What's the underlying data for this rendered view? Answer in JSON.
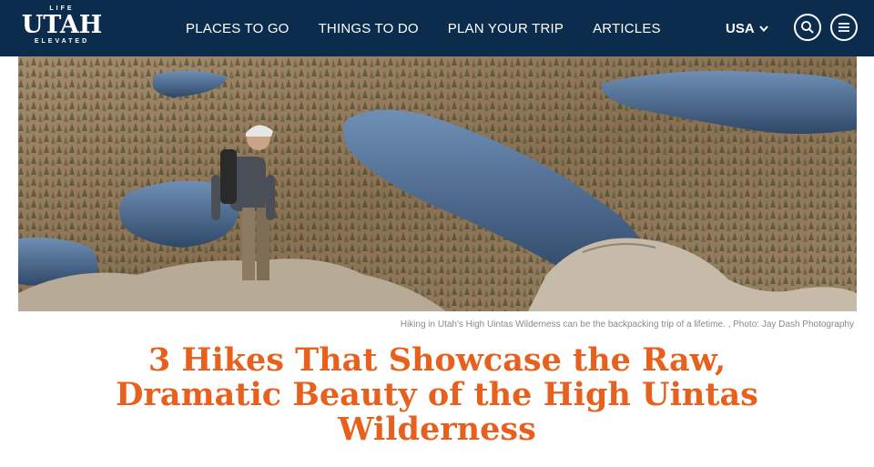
{
  "logo": {
    "top": "LIFE",
    "main": "UTAH",
    "bottom": "ELEVATED"
  },
  "nav": {
    "items": [
      "PLACES TO GO",
      "THINGS TO DO",
      "PLAN YOUR TRIP",
      "ARTICLES"
    ],
    "region": "USA"
  },
  "icons": {
    "search": "search-icon",
    "menu": "menu-icon",
    "region_toggle": "chevron-down-icon"
  },
  "colors": {
    "header_bg": "#0c2c4e",
    "title": "#e8601e",
    "caption": "#8a8a8a"
  },
  "hero": {
    "caption": "Hiking in Utah's High Uintas Wilderness can be the backpacking trip of a lifetime. , Photo: Jay Dash Photography"
  },
  "article": {
    "title_lines": [
      "3 Hikes That Showcase the Raw,",
      "Dramatic Beauty of the High Uintas",
      "Wilderness"
    ]
  }
}
